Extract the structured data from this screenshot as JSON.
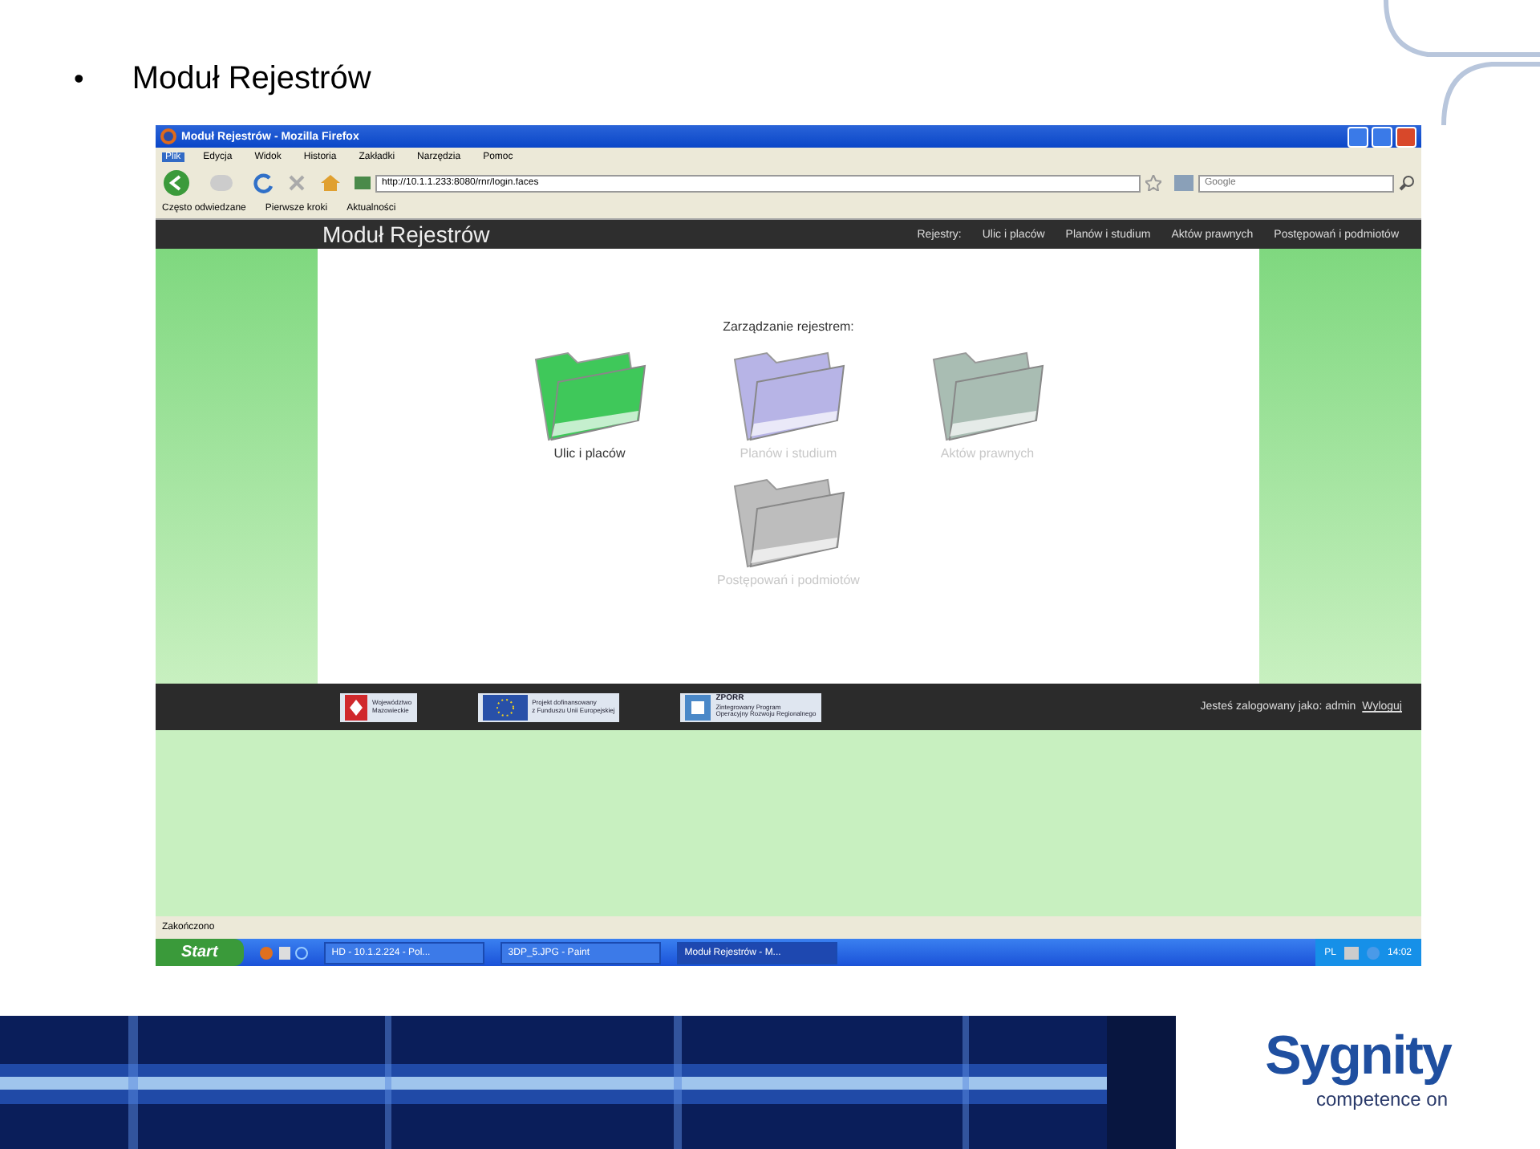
{
  "slide": {
    "bullet": "•",
    "title": "Moduł Rejestrów"
  },
  "window": {
    "title": "Moduł Rejestrów - Mozilla Firefox"
  },
  "menu": [
    {
      "label": "Plik",
      "selected": true
    },
    {
      "label": "Edycja",
      "selected": false
    },
    {
      "label": "Widok",
      "selected": false
    },
    {
      "label": "Historia",
      "selected": false
    },
    {
      "label": "Zakładki",
      "selected": false
    },
    {
      "label": "Narzędzia",
      "selected": false
    },
    {
      "label": "Pomoc",
      "selected": false
    }
  ],
  "address": {
    "value": "http://10.1.1.233:8080/rnr/login.faces"
  },
  "search": {
    "placeholder": "Google"
  },
  "bookmarks": [
    "Często odwiedzane",
    "Pierwsze kroki",
    "Aktualności"
  ],
  "app": {
    "title": "Moduł Rejestrów",
    "nav_label": "Rejestry:",
    "nav": [
      "Ulic i placów",
      "Planów i studium",
      "Aktów prawnych",
      "Postępowań i podmiotów"
    ]
  },
  "content": {
    "heading": "Zarządzanie rejestrem:",
    "registers": [
      {
        "label": "Ulic i placów",
        "disabled": false,
        "color": "#3fc85a"
      },
      {
        "label": "Planów i studium",
        "disabled": true,
        "color": "#b7b4e6"
      },
      {
        "label": "Aktów prawnych",
        "disabled": true,
        "color": "#a9bdb3"
      },
      {
        "label": "Postępowań i podmiotów",
        "disabled": true,
        "color": "#bdbdbd"
      }
    ]
  },
  "footer": {
    "logos": [
      {
        "kind": "eagle",
        "lines": [
          "Województwo",
          "Mazowieckie"
        ]
      },
      {
        "kind": "eu",
        "lines": [
          "Projekt dofinansowany",
          "z Funduszu Unii Europejskiej"
        ]
      },
      {
        "kind": "zporr",
        "lines": [
          "ZPORR",
          "Zintegrowany Program",
          "Operacyjny Rozwoju Regionalnego"
        ]
      }
    ],
    "login_text": "Jesteś zalogowany jako: admin",
    "logout": "Wyloguj"
  },
  "status_bar": "Zakończono",
  "taskbar": {
    "start": "Start",
    "tasks": [
      {
        "label": "HD - 10.1.2.224 - Pol...",
        "selected": false
      },
      {
        "label": "3DP_5.JPG - Paint",
        "selected": false
      },
      {
        "label": "Moduł Rejestrów - M...",
        "selected": true
      }
    ],
    "language": "PL",
    "time": "14:02"
  },
  "logo": {
    "name": "Sygnity",
    "tagline": "competence on"
  }
}
